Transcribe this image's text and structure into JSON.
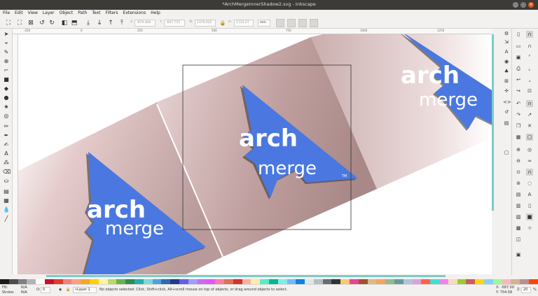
{
  "window": {
    "title": "*ArchMergeInnerShadow2.svg - Inkscape"
  },
  "menu": [
    "File",
    "Edit",
    "View",
    "Layer",
    "Object",
    "Path",
    "Text",
    "Filters",
    "Extensions",
    "Help"
  ],
  "toolbar": {
    "x_label": "X:",
    "x_value": "-879.468",
    "y_label": "Y:",
    "y_value": "-667.755",
    "w_label": "W:",
    "w_value": "2379.022",
    "h_label": "H:",
    "h_value": "1733.27",
    "unit": "mm"
  },
  "ruler": {
    "ticks": [
      "-250",
      "0",
      "250",
      "500",
      "750",
      "1000",
      "1250"
    ]
  },
  "canvas": {
    "logo_word1": "arch",
    "logo_word2": "merge",
    "logo_tm": "TM"
  },
  "status": {
    "fill_label": "Fill:",
    "fill_value": "N/A",
    "stroke_label": "Stroke:",
    "stroke_value": "N/A",
    "opacity_label": "O:",
    "opacity_value": "0",
    "layer": "•Layer 1",
    "message": "No objects selected. Click, Shift+click, Alt+scroll mouse on top of objects, or drag around objects to select.",
    "x_coord": "X: -587.00",
    "y_coord": "Y: 754.58",
    "zoom_label": "Z:",
    "zoom": "20",
    "zoom_unit": "%"
  },
  "colors": {
    "accent": "#4a78e0",
    "bg_rose": "#c9a3a3"
  },
  "palette": [
    "#1a1a1a",
    "#4d4d4d",
    "#7f7f7f",
    "#b3b3b3",
    "#ffffff",
    "#c8102e",
    "#e03c31",
    "#f08080",
    "#ff9f80",
    "#f5a623",
    "#ffd000",
    "#fff3a0",
    "#b8d86b",
    "#6ab04c",
    "#2e8b57",
    "#20b2aa",
    "#7fd8d8",
    "#4aa3df",
    "#2b6cb0",
    "#1e3a8a",
    "#6c5ce7",
    "#a29bfe",
    "#c56cf0",
    "#e056fd",
    "#fd79a8",
    "#e17055",
    "#d63031",
    "#fab1a0",
    "#ffeaa7",
    "#55efc4",
    "#00b894",
    "#81ecec",
    "#74b9ff",
    "#0984e3",
    "#dfe6e9",
    "#b2bec3",
    "#636e72",
    "#2d3436",
    "#fdcb6e",
    "#e84393",
    "#a0522d",
    "#deb887",
    "#f4a460",
    "#8fbc8f",
    "#5f9ea0",
    "#b0c4de",
    "#dda0dd",
    "#ff6347",
    "#40e0d0",
    "#ee82ee",
    "#f5deb3",
    "#9acd32",
    "#cd5c5c",
    "#ffd700",
    "#87cefa",
    "#98fb98",
    "#ffb6c1",
    "#d2b48c",
    "#bc8f8f",
    "#ff4500"
  ]
}
